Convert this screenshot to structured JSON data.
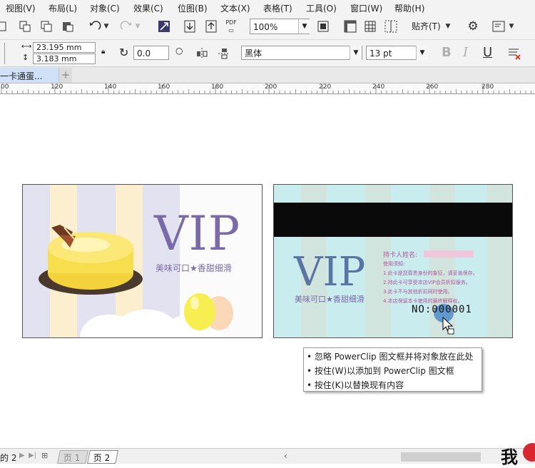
{
  "menu": [
    "视图(V)",
    "布局(L)",
    "对象(C)",
    "效果(C)",
    "位图(B)",
    "文本(X)",
    "表格(T)",
    "工具(O)",
    "窗口(W)",
    "帮助(H)"
  ],
  "toolbar": {
    "zoom_value": "100%",
    "snap_label": "贴齐(T)",
    "pdf_label": "PDF"
  },
  "properties": {
    "width_value": "23.195 mm",
    "height_value": "3.183 mm",
    "rotation_value": "0.0",
    "font_name": "黑体",
    "font_size": "13 pt",
    "bold_label": "B",
    "italic_label": "I",
    "underline_label": "U"
  },
  "document_tab": {
    "label": "一卡通蛋...",
    "add_label": "+"
  },
  "ruler": {
    "labels": [
      "00",
      "120",
      "140",
      "160",
      "180",
      "200",
      "220",
      "240",
      "260",
      "280"
    ]
  },
  "front_card": {
    "vip": "VIP",
    "tagline": "美味可口★香甜细滑"
  },
  "back_card": {
    "vip": "VIP",
    "tagline": "美味可口★香甜细滑",
    "holder_label": "持卡人姓名:",
    "instructions_title": "使用须知:",
    "instructions": [
      "1.此卡是您尊贵身份的象征，请妥善保存。",
      "2.持此卡可享受本店VIP会员折扣服务。",
      "3.此卡不与其他折扣同时使用。",
      "4.本店保留本卡使用的最终解释权。"
    ],
    "number": "NO:000001"
  },
  "tooltip": {
    "lines": [
      "• 忽略 PowerClip 图文框并将对象放在此处",
      "• 按住(W)以添加到 PowerClip 图文框",
      "• 按住(K)以替换现有内容"
    ]
  },
  "status": {
    "page_count": "的 2",
    "page1": "页 1",
    "page2": "页 2",
    "watermark": "我"
  },
  "colors": {
    "accent_purple": "#7a6aa8",
    "card_back_bg": "#c9ecef",
    "stripe_lavender": "#e3e2f1",
    "stripe_cream": "#fcefd0",
    "watermark_red": "#d8272e"
  }
}
